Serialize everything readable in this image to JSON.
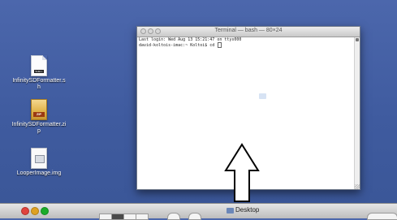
{
  "desktop": {
    "icons": [
      {
        "name": "InfinitySDFormatter.sh",
        "label_lines": [
          "InfinitySDFormatter.s",
          "h"
        ],
        "badge": "SHELL"
      },
      {
        "name": "InfinitySDFormatter.zip",
        "label_lines": [
          "InfinitySDFormatter.zi",
          "p"
        ],
        "badge": "ZIP"
      },
      {
        "name": "LooperImage.img",
        "label_lines": [
          "LooperImage.img"
        ]
      }
    ]
  },
  "terminal": {
    "title": "Terminal — bash — 80×24",
    "lines": [
      "Last login: Wed Aug 13 15:21:47 on ttys000",
      "david-koltois-imac:~ Koltoi$ cd "
    ]
  },
  "finder": {
    "title": "Desktop"
  },
  "colors": {
    "desktop_bg": "#4563a8",
    "close": "#e0443e",
    "minimize": "#dea123",
    "zoom": "#1aab29"
  },
  "icons": [
    "shell-script-icon",
    "zip-archive-icon",
    "disk-image-icon",
    "up-arrow-icon",
    "folder-icon"
  ]
}
